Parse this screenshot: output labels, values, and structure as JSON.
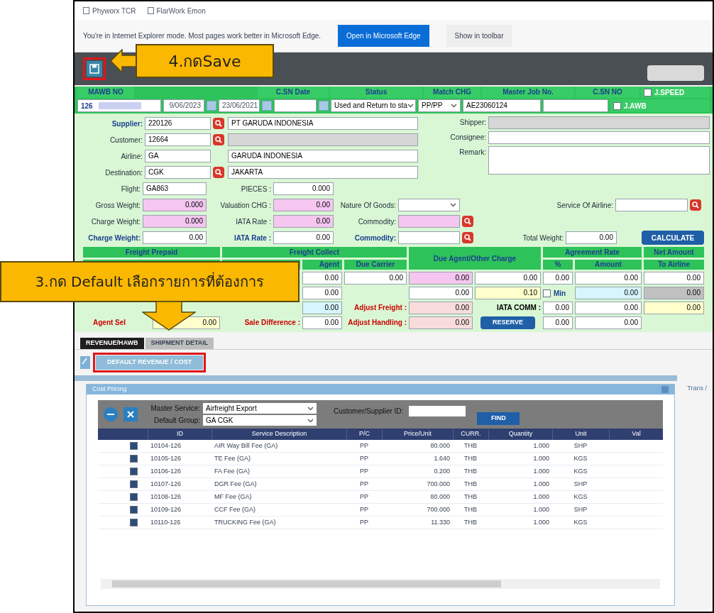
{
  "favorites": [
    {
      "label": "Phyworx TCR"
    },
    {
      "label": "FlarWork Emon"
    }
  ],
  "ie_bar": {
    "message": "You're in Internet Explorer mode. Most pages work better in Microsoft Edge.",
    "open_button": "Open in Microsoft Edge",
    "toolbar_button": "Show in toolbar"
  },
  "header": {
    "columns": [
      {
        "kind": "label",
        "label": "MAWB NO"
      },
      {
        "kind": "label",
        "label": "C.SN Date"
      },
      {
        "kind": "label",
        "label": "Status"
      },
      {
        "kind": "label",
        "label": "Match CHG"
      },
      {
        "kind": "label",
        "label": "Master Job No."
      },
      {
        "kind": "label",
        "label": "C.SN NO"
      },
      {
        "kind": "check",
        "label": "J.SPEED",
        "checked": false
      }
    ],
    "mawb_prefix": "126",
    "date_1": "9/06/2023",
    "date_2": "23/06/2021",
    "status": "Used and Return to sta",
    "match_chg": "PP/PP",
    "master_job_no": "AE23060124",
    "awb_check": {
      "label": "J.AWB",
      "checked": false
    }
  },
  "parties": [
    {
      "label": "Supplier:",
      "emphasis": true,
      "code": "220126",
      "lookup": true,
      "name": "PT GARUDA INDONESIA",
      "hidden": false
    },
    {
      "label": "Customer:",
      "emphasis": false,
      "code": "12664",
      "lookup": true,
      "hidden": true
    },
    {
      "label": "Airline:",
      "emphasis": false,
      "code": "GA",
      "lookup": false,
      "name": "GARUDA INDONESIA",
      "hidden": false
    },
    {
      "label": "Destination:",
      "emphasis": false,
      "code": "CGK",
      "lookup": true,
      "name": "JAKARTA",
      "hidden": false
    }
  ],
  "contacts": [
    {
      "label": "Shipper:",
      "kind": "hidden"
    },
    {
      "label": "Consignee:",
      "kind": "field"
    },
    {
      "label": "Remark:",
      "kind": "textarea"
    }
  ],
  "weights": [
    [
      {
        "kind": "label",
        "text": "Flight:",
        "blue": false
      },
      {
        "kind": "code",
        "value": "GA863",
        "color": "#ffffff"
      },
      {
        "kind": "label",
        "text": "PIECES :",
        "blue": false
      },
      {
        "kind": "field",
        "value": "0.000",
        "color": "#ffffff"
      }
    ],
    [
      {
        "kind": "label",
        "text": "Gross Weight:",
        "blue": false
      },
      {
        "kind": "field",
        "value": "0.000",
        "color": "#f5c6f0"
      },
      {
        "kind": "label",
        "text": "Valuation CHG :",
        "blue": false
      },
      {
        "kind": "field",
        "value": "0.00",
        "color": "#f5c6f0"
      },
      {
        "kind": "label",
        "text": "Nature Of Goods:",
        "blue": false
      },
      {
        "kind": "select"
      },
      {
        "kind": "blank"
      },
      {
        "kind": "label",
        "text": "Service Of Airline:",
        "blue": false
      },
      {
        "kind": "wide"
      },
      {
        "kind": "lookup"
      }
    ],
    [
      {
        "kind": "label",
        "text": "Charge Weight:",
        "blue": false
      },
      {
        "kind": "field",
        "value": "0.000",
        "color": "#f5c6f0"
      },
      {
        "kind": "label",
        "text": "IATA Rate :",
        "blue": false
      },
      {
        "kind": "field",
        "value": "0.00",
        "color": "#f5c6f0"
      },
      {
        "kind": "label",
        "text": "Commodity:",
        "blue": false
      },
      {
        "kind": "empty",
        "color": "#f5c6f0"
      },
      {
        "kind": "lookup"
      }
    ],
    [
      {
        "kind": "label",
        "text": "Charge Weight:",
        "blue": true
      },
      {
        "kind": "field",
        "value": "0.00",
        "color": "#ffffff"
      },
      {
        "kind": "label",
        "text": "IATA Rate :",
        "blue": true
      },
      {
        "kind": "field",
        "value": "0.00",
        "color": "#ffffff"
      },
      {
        "kind": "label",
        "text": "Commodity:",
        "blue": true
      },
      {
        "kind": "empty",
        "color": "#ffffff"
      },
      {
        "kind": "lookup"
      },
      {
        "kind": "label",
        "text": "Total Weight:",
        "blue": false
      },
      {
        "kind": "field",
        "value": "0.00",
        "color": "#ffffff"
      },
      {
        "kind": "button",
        "text": "CALCULATE"
      }
    ]
  ],
  "charge_table": {
    "groups": [
      "Freight Prepaid",
      "Freight Collect",
      "Due Agent/Other Charge",
      "Agreement Rate",
      "Net Amount"
    ],
    "sub_headers": [
      "Agent",
      "Due Carrier",
      "%",
      "Amount",
      "To Airline"
    ],
    "rows": [
      {
        "cells": [
          {
            "kind": "blank"
          },
          {
            "kind": "blank"
          },
          {
            "kind": "blank"
          },
          {
            "kind": "field",
            "text": "0.00",
            "color": "#ffffff"
          },
          {
            "kind": "field",
            "text": "0.00",
            "color": "#ffffff"
          },
          {
            "kind": "field",
            "text": "0.00",
            "color": "#f5c6f0"
          },
          {
            "kind": "field",
            "text": "0.00",
            "color": "#ffffff"
          },
          {
            "kind": "field",
            "text": "0.00",
            "color": "#ffffff"
          },
          {
            "kind": "field",
            "text": "0.00",
            "color": "#ffffff"
          },
          {
            "kind": "field",
            "text": "0.00",
            "color": "#ffffff"
          }
        ]
      },
      {
        "cells": [
          {
            "kind": "blank"
          },
          {
            "kind": "blank"
          },
          {
            "kind": "blank"
          },
          {
            "kind": "field",
            "text": "0.00",
            "color": "#ffffff"
          },
          {
            "kind": "blank"
          },
          {
            "kind": "field",
            "text": "0.00",
            "color": "#ffffff"
          },
          {
            "kind": "field",
            "text": "0.10",
            "color": "#ffffcc"
          },
          {
            "kind": "check",
            "text": "Min",
            "checked": false
          },
          {
            "kind": "field",
            "text": "0.00",
            "color": "#d6f5ff"
          },
          {
            "kind": "field",
            "text": "0.00",
            "color": "#c0c0c0"
          }
        ]
      },
      {
        "cells": [
          {
            "kind": "blank"
          },
          {
            "kind": "blank"
          },
          {
            "kind": "blank"
          },
          {
            "kind": "field",
            "text": "0.00",
            "color": "#d6f5ff"
          },
          {
            "kind": "label",
            "text": "Adjust Freight :",
            "color": "#cc0000"
          },
          {
            "kind": "field",
            "text": "0.00",
            "color": "#f8dcdc"
          },
          {
            "kind": "label",
            "text": "IATA COMM :",
            "color": "#000000"
          },
          {
            "kind": "field",
            "text": "0.00",
            "color": "#ffffff"
          },
          {
            "kind": "field",
            "text": "0.00",
            "color": "#ffffff"
          },
          {
            "kind": "field",
            "text": "0.00",
            "color": "#ffffcc"
          }
        ]
      },
      {
        "cells": [
          {
            "kind": "label",
            "text": "Agent Sel",
            "color": "#cc0000"
          },
          {
            "kind": "field",
            "text": "0.00",
            "color": "#ffffcc"
          },
          {
            "kind": "label",
            "text": "Sale Difference :",
            "color": "#cc0000"
          },
          {
            "kind": "field",
            "text": "0.00",
            "color": "#ffffff"
          },
          {
            "kind": "label",
            "text": "Adjust Handling :",
            "color": "#cc0000"
          },
          {
            "kind": "field",
            "text": "0.00",
            "color": "#f8dcdc"
          },
          {
            "kind": "button",
            "text": "RESERVE"
          },
          {
            "kind": "field",
            "text": "0.00",
            "color": "#ffffff"
          },
          {
            "kind": "field",
            "text": "0.00",
            "color": "#ffffff"
          },
          {
            "kind": "blank"
          }
        ]
      }
    ]
  },
  "tabs": [
    {
      "label": "REVENUE/HAWB",
      "selected": true
    },
    {
      "label": "SHIPMENT DETAIL",
      "selected": false
    }
  ],
  "default_button": "DEFAULT REVENUE / COST",
  "side_label": "Trans /",
  "dialog": {
    "title": "Cost Pricing",
    "master_service_label": "Master Service:",
    "master_service": "Airfreight Export",
    "default_group_label": "Default Group:",
    "default_group": "GA CGK",
    "customer_label": "Customer/Supplier ID:",
    "find_button": "FIND",
    "columns": [
      "ID",
      "Service Description",
      "P/C",
      "Price/Unit",
      "CURR.",
      "Quantity",
      "Unit",
      "Val"
    ],
    "rows": [
      {
        "checked": true,
        "cells": [
          "10104-126",
          "AIR Way Bill Fee (GA)",
          "PP",
          "80.000",
          "THB",
          "1.000",
          "SHP"
        ]
      },
      {
        "checked": true,
        "cells": [
          "10105-126",
          "TE Fee (GA)",
          "PP",
          "1.640",
          "THB",
          "1.000",
          "KGS"
        ]
      },
      {
        "checked": true,
        "cells": [
          "10106-126",
          "FA Fee (GA)",
          "PP",
          "0.200",
          "THB",
          "1.000",
          "KGS"
        ]
      },
      {
        "checked": true,
        "cells": [
          "10107-126",
          "DGR Fee (GA)",
          "PP",
          "700.000",
          "THB",
          "1.000",
          "SHP"
        ]
      },
      {
        "checked": true,
        "cells": [
          "10108-126",
          "MF Fee (GA)",
          "PP",
          "80.000",
          "THB",
          "1.000",
          "KGS"
        ]
      },
      {
        "checked": true,
        "cells": [
          "10109-126",
          "CCF Fee (GA)",
          "PP",
          "700.000",
          "THB",
          "1.000",
          "SHP"
        ]
      },
      {
        "checked": true,
        "cells": [
          "10110-126",
          "TRUCKING Fee (GA)",
          "PP",
          "11.330",
          "THB",
          "1.000",
          "KGS"
        ]
      }
    ]
  },
  "callouts": [
    {
      "kind": "left",
      "text": "4.กดSave"
    },
    {
      "kind": "down",
      "text": "3.กด Default เลือกรายการที่ต้องการ"
    }
  ]
}
